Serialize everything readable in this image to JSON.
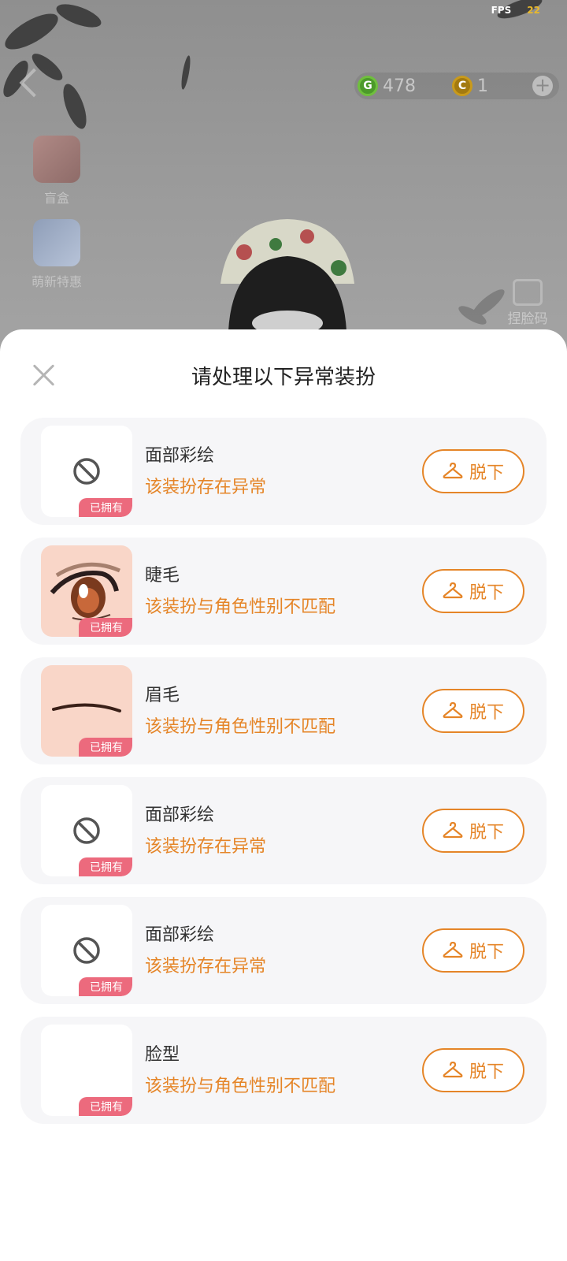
{
  "status": {
    "fps_label": "FPS",
    "fps_value": "22"
  },
  "currency": {
    "green_amount": "478",
    "gold_amount": "1",
    "green_symbol": "G",
    "gold_symbol": "C"
  },
  "sidebar": [
    {
      "label": "盲盒",
      "icon": "gift-box-icon"
    },
    {
      "label": "萌新特惠",
      "icon": "outfit-bundle-icon"
    }
  ],
  "pinch_face": {
    "label": "捏脸码",
    "icon": "edit-face-icon"
  },
  "dialog": {
    "title": "请处理以下异常装扮",
    "owned_badge": "已拥有",
    "remove_label": "脱下",
    "items": [
      {
        "name": "面部彩绘",
        "message": "该装扮存在异常",
        "thumb": "ban-icon"
      },
      {
        "name": "睫毛",
        "message": "该装扮与角色性别不匹配",
        "thumb": "eye-lash-icon"
      },
      {
        "name": "眉毛",
        "message": "该装扮与角色性别不匹配",
        "thumb": "eyebrow-icon"
      },
      {
        "name": "面部彩绘",
        "message": "该装扮存在异常",
        "thumb": "ban-icon"
      },
      {
        "name": "面部彩绘",
        "message": "该装扮存在异常",
        "thumb": "ban-icon"
      },
      {
        "name": "脸型",
        "message": "该装扮与角色性别不匹配",
        "thumb": "blank"
      }
    ]
  },
  "colors": {
    "accent": "#e58528",
    "badge": "#ec6a7d",
    "row_bg": "#f6f6f8"
  }
}
